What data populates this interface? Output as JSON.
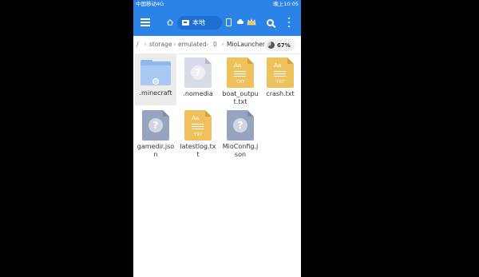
{
  "status_bar": {
    "carrier": "中国移动4G",
    "time": "晚上10:05"
  },
  "toolbar": {
    "local_tab_label": "本地"
  },
  "breadcrumb": {
    "root": "/",
    "items": [
      "storage",
      "emulated",
      "0",
      "MioLauncher"
    ],
    "storage_percent": "67%"
  },
  "files": [
    {
      "name": ".minecraft",
      "type": "folder",
      "selected": true
    },
    {
      "name": ".nomedia",
      "type": "unknown"
    },
    {
      "name": "boat_output.txt",
      "type": "text",
      "badge": "TXT"
    },
    {
      "name": "crash.txt",
      "type": "text",
      "badge": "TXT"
    },
    {
      "name": "gamedir.json",
      "type": "unknown"
    },
    {
      "name": "latestlog.txt",
      "type": "text",
      "badge": "TXT"
    },
    {
      "name": "MioConfig.json",
      "type": "unknown"
    }
  ],
  "icons": {
    "aa_label": "Aa"
  },
  "colors": {
    "toolbar_blue": "#2b83e8",
    "folder_blue": "#a9c8f4",
    "text_file_yellow": "#efc15c",
    "unknown_file_gray": "#97a4bf",
    "selected_bg": "#ececec"
  }
}
